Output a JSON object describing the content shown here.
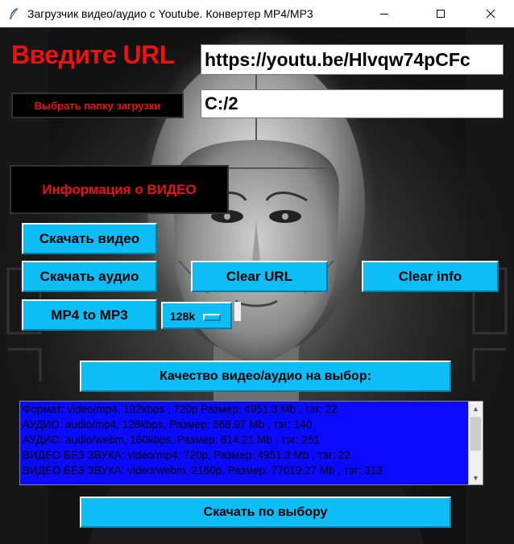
{
  "window": {
    "title": "Загрузчик видео/аудио с Youtube. Конвертер MP4/MP3",
    "controls": [
      "minimize-icon",
      "maximize-icon",
      "close-icon"
    ]
  },
  "url_label": "Введите URL",
  "url_input": {
    "value": "https://youtu.be/Hlvqw74pCFc"
  },
  "folder_button": {
    "label": "Выбрать папку загрузки"
  },
  "folder_input": {
    "value": "C:/2"
  },
  "info_button": {
    "label": "Информация о ВИДЕО"
  },
  "buttons": {
    "download_video": "Скачать видео",
    "download_audio": "Скачать аудио",
    "clear_url": "Clear URL",
    "clear_info": "Clear info",
    "mp4_to_mp3": "MP4 to MP3",
    "quality": "Качество видео/аудио на выбор:",
    "download_selected": "Скачать по выбору"
  },
  "bitrate_select": {
    "value": "128k"
  },
  "formats_list": [
    "Формат: video/mp4, 192kbps , 720p Размер:  4951.3 Mb , тэг: 22",
    "АУДИО: audio/mp4,  128kbps, Размер:  568.97 Mb , тэг: 140",
    "АУДИО: audio/webm,  160kbps, Размер:  614.21 Mb , тэг: 251",
    "ВИДЕО БЕЗ ЗВУКА: video/mp4,  720p,  Размер:  4951.3 Mb ,  тэг: 22",
    "ВИДЕО БЕЗ ЗВУКА: video/webm,  2160p,  Размер:  77019.27 Mb ,  тэг: 313"
  ],
  "colors": {
    "accent_button": "#0ebdf5",
    "label_red": "#ee1111",
    "listbox_bg": "#0a0aff"
  }
}
